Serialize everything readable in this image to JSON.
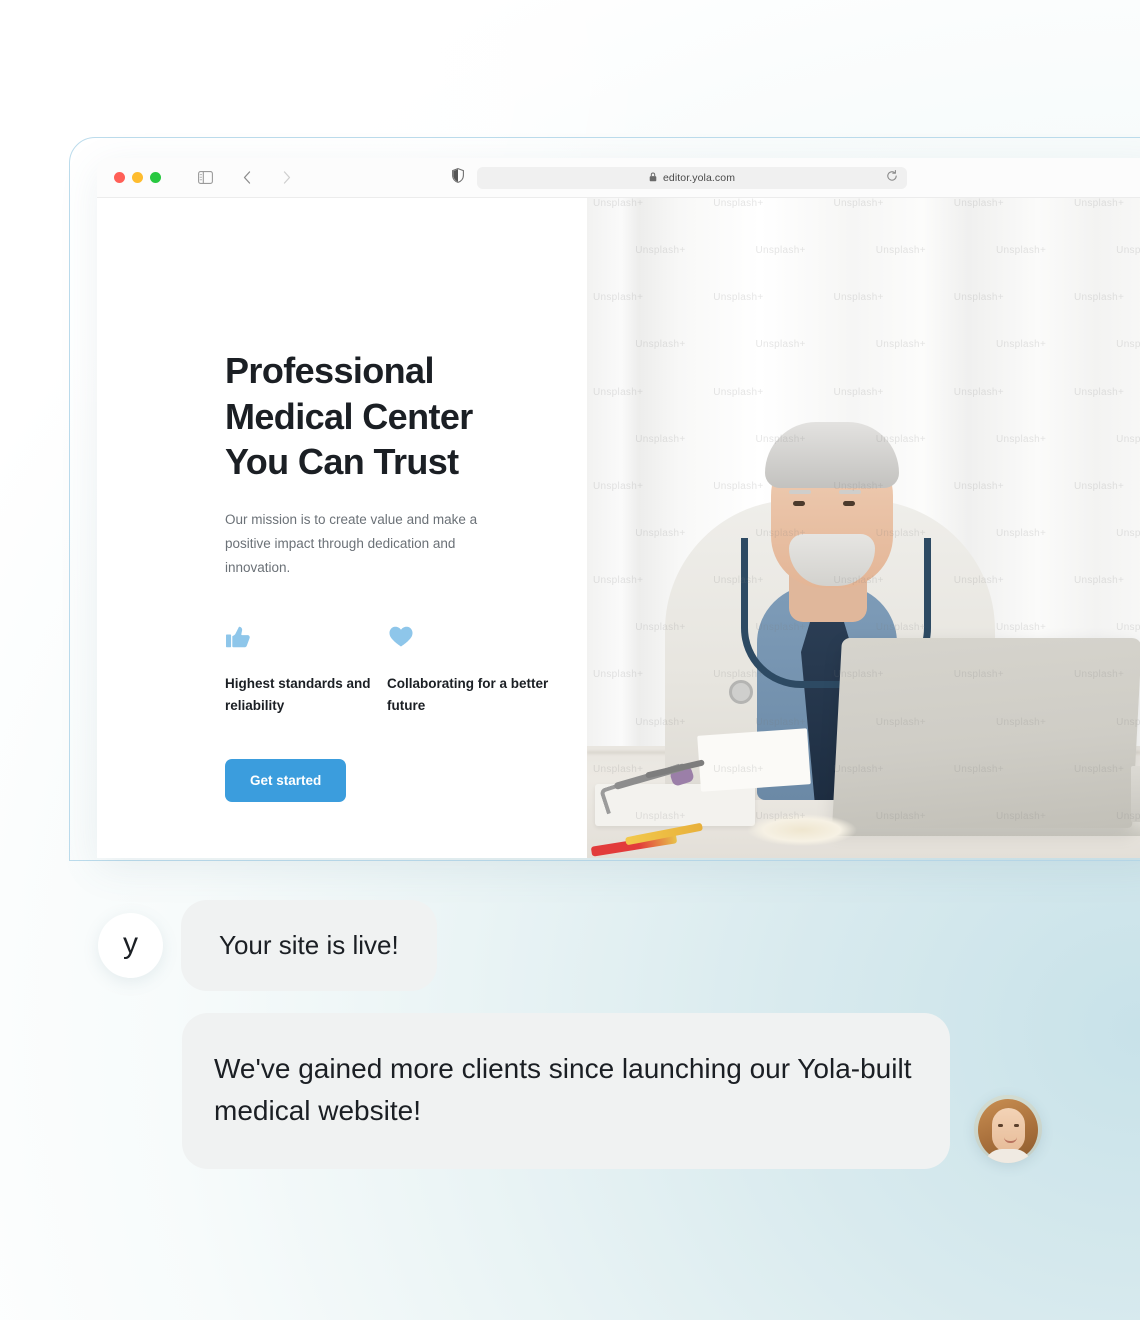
{
  "browser": {
    "window_controls": [
      "close",
      "minimize",
      "maximize"
    ],
    "sidebar_icon": "sidebar-toggle-icon",
    "back_icon": "chevron-left-icon",
    "forward_icon": "chevron-right-icon",
    "shield_icon": "shield-privacy-icon",
    "lock_icon": "lock-icon",
    "url": "editor.yola.com",
    "reload_icon": "reload-icon"
  },
  "site": {
    "title": "Professional Medical Center You Can Trust",
    "subtitle": "Our mission is to create value and make a positive impact through dedication and innovation.",
    "features": [
      {
        "icon": "thumbs-up-icon",
        "label": "Highest standards and reliability"
      },
      {
        "icon": "heart-icon",
        "label": "Collaborating for a better future"
      }
    ],
    "cta_label": "Get started",
    "hero_image_alt": "Senior doctor in white coat with stethoscope sitting at a desk with a laptop",
    "watermark": "Unsplash+"
  },
  "chat": {
    "brand_avatar_letter": "y",
    "messages": [
      {
        "id": "system",
        "text": "Your site is live!"
      },
      {
        "id": "testimonial",
        "text": "We've gained more clients since launching our Yola-built medical website!"
      }
    ],
    "person_avatar_alt": "Smiling woman with long light-brown hair"
  },
  "colors": {
    "accent_blue": "#3b9ddd",
    "icon_blue": "#8ec6ea",
    "bubble_gray": "#f0f2f2",
    "heading_dark": "#1b1f24",
    "body_gray": "#6b7177",
    "page_teal": "#cfe5ea",
    "window_border": "#bcdcec"
  }
}
